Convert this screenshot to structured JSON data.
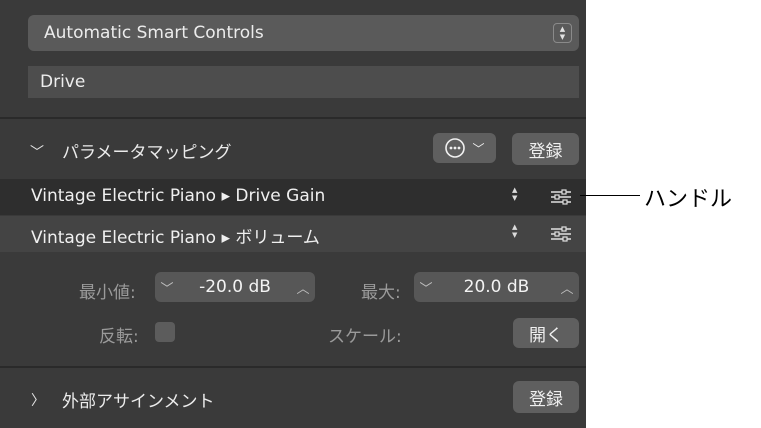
{
  "mode_select": {
    "value": "Automatic Smart Controls"
  },
  "control_name": {
    "value": "Drive"
  },
  "parameter_mapping": {
    "title": "パラメータマッピング",
    "more_icon": "ellipsis-circle-icon",
    "learn_label": "登録",
    "mappings": [
      {
        "label": "Vintage Electric Piano ▸ Drive Gain",
        "selected": true
      },
      {
        "label": "Vintage Electric Piano ▸ ボリューム",
        "selected": false
      }
    ],
    "min_label": "最小値:",
    "min_value": "-20.0 dB",
    "max_label": "最大:",
    "max_value": "20.0 dB",
    "invert_label": "反転:",
    "invert_checked": false,
    "scale_label": "スケール:",
    "scale_open_label": "開く"
  },
  "external_assignments": {
    "title": "外部アサインメント",
    "learn_label": "登録"
  },
  "callout": {
    "text": "ハンドル"
  },
  "colors": {
    "panel_bg": "#3a3a3a",
    "row_selected": "#2e2e2e",
    "row_normal": "#444444",
    "button_bg": "#5f5f5f"
  }
}
